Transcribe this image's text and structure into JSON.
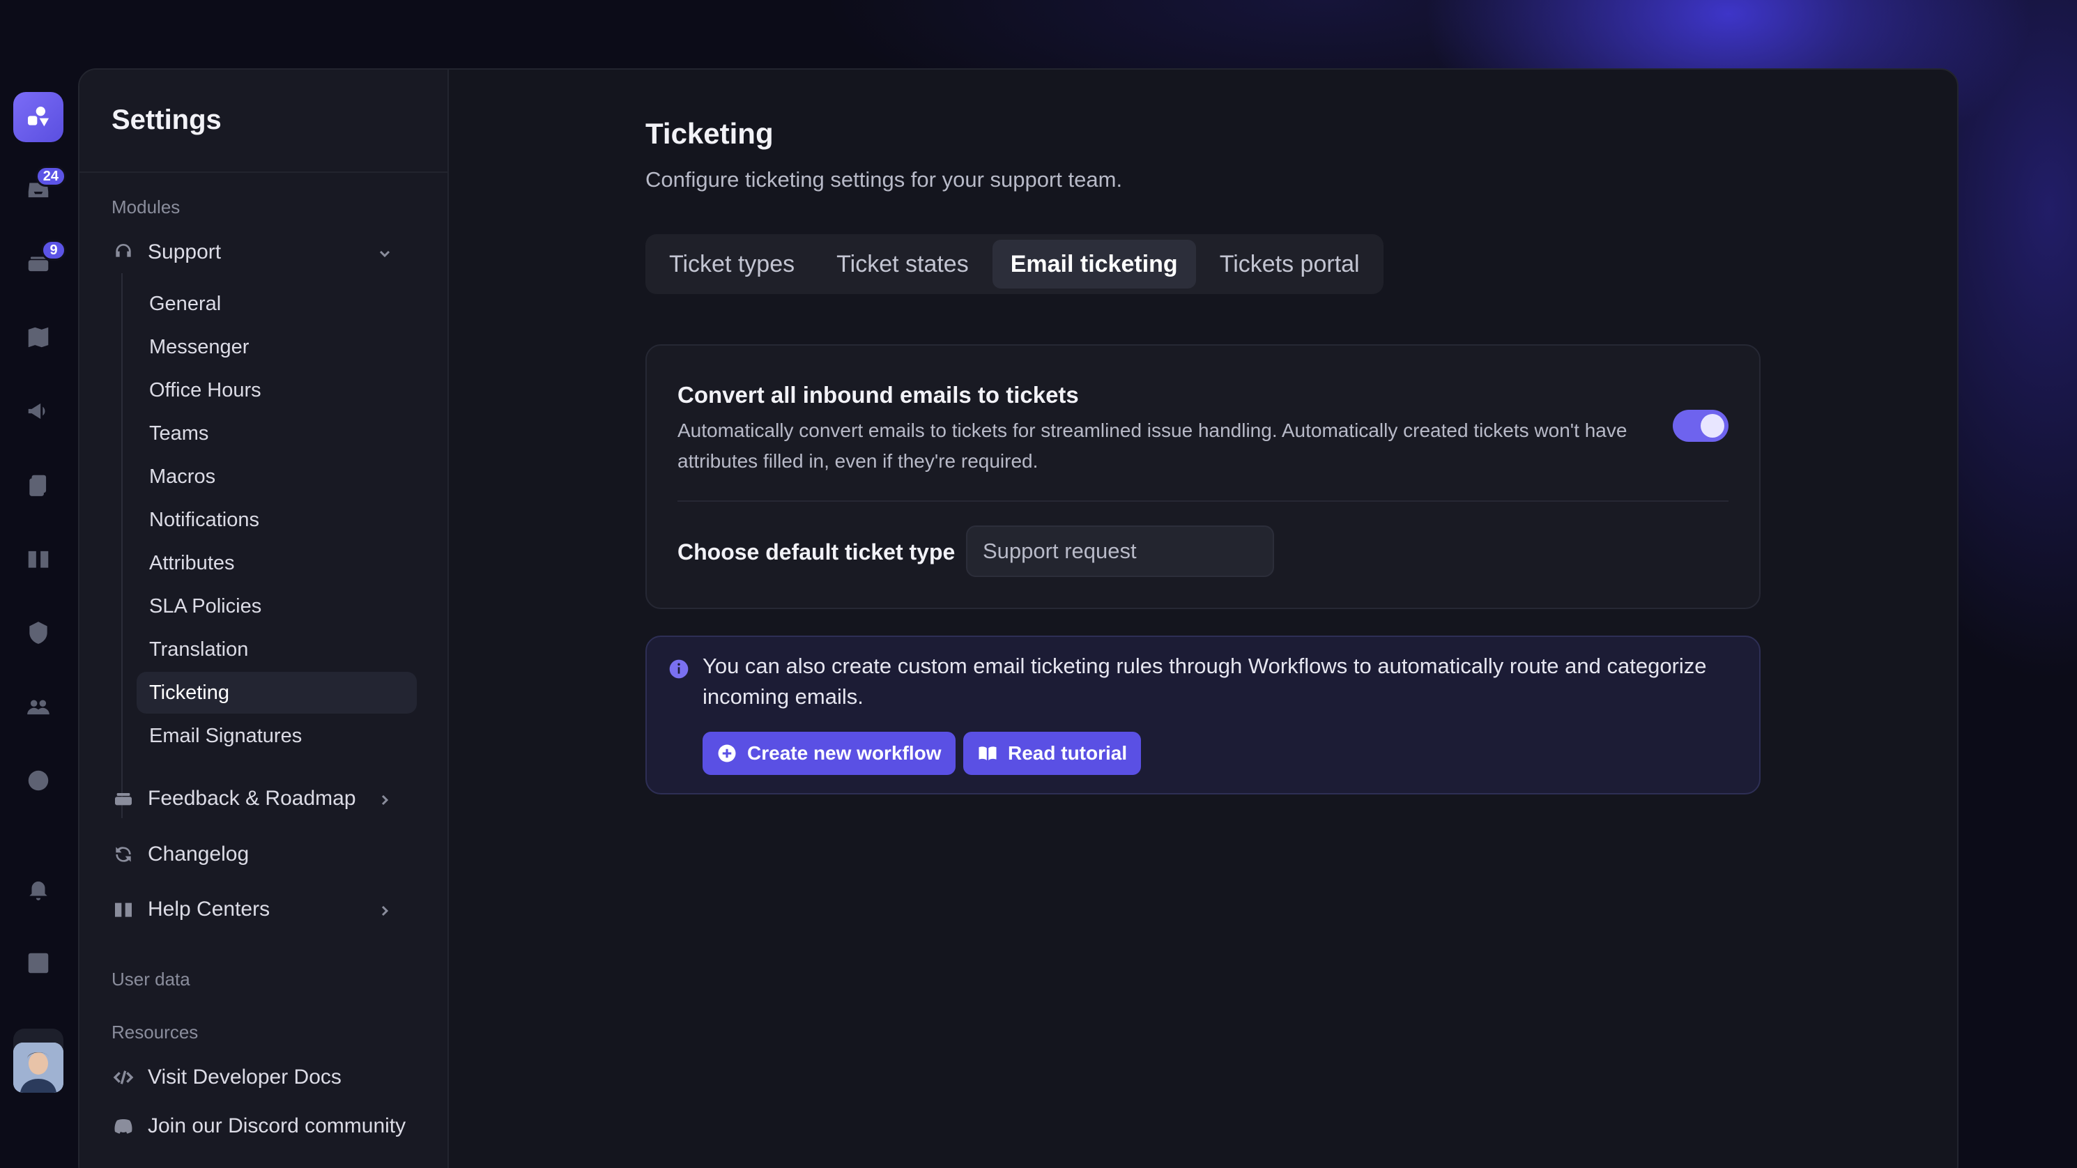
{
  "rail": {
    "badges": {
      "inbox": "24",
      "tickets": "9"
    },
    "icons": [
      "app-logo-icon",
      "inbox-icon",
      "ticket-stack-icon",
      "map-icon",
      "megaphone-icon",
      "documents-icon",
      "book-icon",
      "shield-icon",
      "people-icon",
      "globe-icon",
      "bell-icon",
      "chart-icon",
      "gear-icon"
    ]
  },
  "sidebar": {
    "title": "Settings",
    "modules_label": "Modules",
    "support_label": "Support",
    "support_items": [
      "General",
      "Messenger",
      "Office Hours",
      "Teams",
      "Macros",
      "Notifications",
      "Attributes",
      "SLA Policies",
      "Translation",
      "Ticketing",
      "Email Signatures"
    ],
    "active_item": "Ticketing",
    "feedback_label": "Feedback & Roadmap",
    "changelog_label": "Changelog",
    "help_centers_label": "Help Centers",
    "user_data_label": "User data",
    "resources_label": "Resources",
    "dev_docs_label": "Visit Developer Docs",
    "discord_label": "Join our Discord community"
  },
  "main": {
    "title": "Ticketing",
    "subtitle": "Configure ticketing settings for your support team.",
    "tabs": [
      "Ticket types",
      "Ticket states",
      "Email ticketing",
      "Tickets portal"
    ],
    "active_tab": "Email ticketing",
    "card": {
      "title": "Convert all inbound emails to tickets",
      "description": "Automatically convert emails to tickets for streamlined issue handling. Automatically created tickets won't have attributes filled in, even if they're required.",
      "toggle_on": true,
      "default_type_label": "Choose default ticket type",
      "default_type_value": "Support request"
    },
    "info": {
      "text": "You can also create custom email ticketing rules through Workflows to automatically route and categorize incoming emails.",
      "create_button": "Create new workflow",
      "tutorial_button": "Read tutorial"
    }
  },
  "colors": {
    "accent": "#5a50e4",
    "toggle": "#6e63ee",
    "background": "#14151e"
  }
}
